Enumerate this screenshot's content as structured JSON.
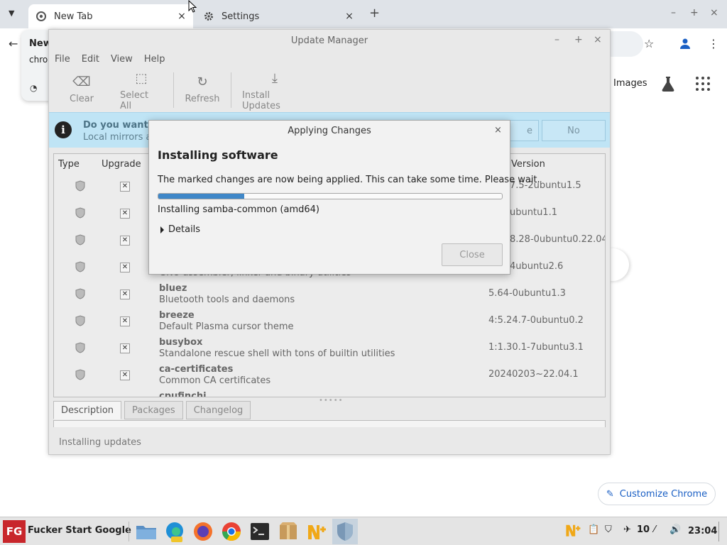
{
  "chrome": {
    "tabs": [
      {
        "title": "New Tab",
        "close": "×"
      },
      {
        "title": "Settings",
        "close": "×"
      }
    ],
    "new_tab": "+",
    "window_controls": {
      "minimize": "–",
      "maximize": "+",
      "close": "×"
    },
    "popup": {
      "title": "New",
      "url": "chro"
    },
    "images_link": "Images",
    "customize_button": "Customize Chrome"
  },
  "update_manager": {
    "title": "Update Manager",
    "window_controls": {
      "minimize": "–",
      "maximize": "+",
      "close": "×"
    },
    "menu": [
      "File",
      "Edit",
      "View",
      "Help"
    ],
    "toolbar": {
      "clear": "Clear",
      "select_all": "Select All",
      "refresh": "Refresh",
      "install_updates": "Install Updates"
    },
    "info_bar": {
      "title": "Do you want to",
      "subtitle": "Local mirrors ar",
      "button_partial": "e",
      "button_no": "No"
    },
    "columns": {
      "type": "Type",
      "upgrade": "Upgrade",
      "version": "Version"
    },
    "packages": [
      {
        "name": "",
        "desc": "",
        "version": "7.5-2ubuntu1.5",
        "cut": true
      },
      {
        "name": "",
        "desc": "",
        "version": "ubuntu1.1",
        "cut": true
      },
      {
        "name": "",
        "desc": "",
        "version": "8.28-0ubuntu0.22.04.",
        "cut": true
      },
      {
        "name": "",
        "desc": "GNU assembler, linker and binary utilities",
        "version": "4ubuntu2.6",
        "cut": true
      },
      {
        "name": "bluez",
        "desc": "Bluetooth tools and daemons",
        "version": "5.64-0ubuntu1.3",
        "cut": false
      },
      {
        "name": "breeze",
        "desc": "Default Plasma cursor theme",
        "version": "4:5.24.7-0ubuntu0.2",
        "cut": false
      },
      {
        "name": "busybox",
        "desc": "Standalone rescue shell with tons of builtin utilities",
        "version": "1:1.30.1-7ubuntu3.1",
        "cut": false
      },
      {
        "name": "ca-certificates",
        "desc": "Common CA certificates",
        "version": "20240203~22.04.1",
        "cut": false
      },
      {
        "name": "cpufinchi",
        "desc": "",
        "version": "",
        "cut": false
      }
    ],
    "bottom_tabs": [
      "Description",
      "Packages",
      "Changelog"
    ],
    "status": "Installing updates"
  },
  "dialog": {
    "title": "Applying Changes",
    "close_x": "×",
    "heading": "Installing software",
    "message": "The marked changes are now being applied. This can take some time. Please wait.",
    "progress": 0.25,
    "status": "Installing samba-common (amd64)",
    "details": "Details",
    "close_button": "Close"
  },
  "taskbar": {
    "start_logo": "FG",
    "start_label": "Fucker Start Google",
    "tray_count": "10",
    "clock": "23:04"
  },
  "colors": {
    "progress": "#3f87c8",
    "info_bar": "#bfe4f5",
    "start_logo": "#c8262b"
  }
}
